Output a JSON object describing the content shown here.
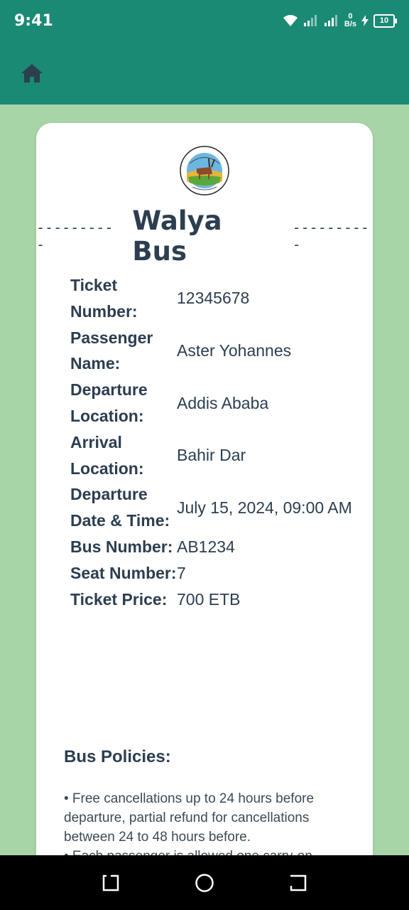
{
  "status_bar": {
    "time": "9:41",
    "net_speed_value": "0",
    "net_speed_unit": "B/s",
    "battery": "10"
  },
  "app_bar": {
    "home_icon": "home-icon"
  },
  "ticket": {
    "logo_alt": "ዋልያ ባስ WALYA BUS",
    "title": "Walya Bus",
    "dash_left": "----------",
    "dash_right": "----------",
    "fields": [
      {
        "label": "Ticket Number:",
        "value": "12345678"
      },
      {
        "label": "Passenger Name:",
        "value": "Aster Yohannes"
      },
      {
        "label": "Departure Location:",
        "value": "Addis Ababa"
      },
      {
        "label": "Arrival Location:",
        "value": "Bahir Dar"
      },
      {
        "label": "Departure Date & Time:",
        "value": "July 15, 2024, 09:00 AM"
      },
      {
        "label": "Bus Number:",
        "value": "AB1234"
      },
      {
        "label": "Seat Number:",
        "value": "7"
      },
      {
        "label": "Ticket Price:",
        "value": "700 ETB"
      }
    ],
    "policies_heading": "Bus Policies:",
    "policy_text": "• Free cancellations up to 24 hours before departure, partial refund for cancellations between 24 to 48 hours before.\n• Each passenger is allowed one carry-on"
  },
  "colors": {
    "app_bar": "#1a8a74",
    "background": "#a8d5a7",
    "text_dark": "#2c3e50"
  }
}
